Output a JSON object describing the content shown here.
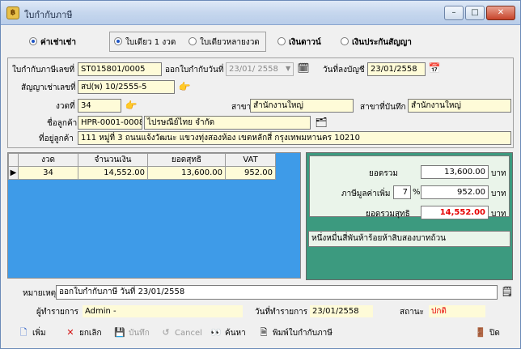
{
  "window": {
    "title": "ใบกำกับภาษี",
    "min": "–",
    "max": "□",
    "close": "✕"
  },
  "tax_type": {
    "options": [
      "ค่าเช่าเช่า",
      "เงินดาวน์",
      "เงินประกันสัญญา"
    ],
    "selected": "ค่าเช่าเช่า"
  },
  "invoice_mode": {
    "options": [
      "ใบเดียว 1 งวด",
      "ใบเดียวหลายงวด"
    ],
    "selected": "ใบเดียว 1 งวด"
  },
  "form": {
    "invoice_no_label": "ใบกำกับภาษีเลขที่",
    "invoice_no": "ST015801/0005",
    "issue_date_label": "ออกใบกำกับวันที่",
    "issue_date": "23/01/ 2558",
    "posting_date_label": "วันที่ลงบัญชี",
    "posting_date": "23/01/2558",
    "contract_no_label": "สัญญาเช่าเลขที่",
    "contract_no": "สป(พ) 10/2555-5",
    "installment_label": "งวดที่",
    "installment": "34",
    "branch_label": "สาขา",
    "branch": "สำนักงานใหญ่",
    "record_branch_label": "สาขาที่บันทึก",
    "record_branch": "สำนักงานใหญ่",
    "customer_name_label": "ชื่อลูกค้า",
    "customer_code": "HPR-0001-00082",
    "customer_name": "ไปรษณีย์ไทย จำกัด",
    "customer_address_label": "ที่อยู่ลูกค้า",
    "customer_address": "111 หมู่ที่ 3 ถนนแจ้งวัฒนะ แขวงทุ่งสองห้อง เขตหลักสี่ กรุงเทพมหานคร 10210"
  },
  "grid": {
    "columns": [
      "งวด",
      "จำนวนเงิน",
      "ยอดสุทธิ",
      "VAT"
    ],
    "rows": [
      {
        "installment": "34",
        "amount": "14,552.00",
        "net": "13,600.00",
        "vat": "952.00"
      }
    ]
  },
  "summary": {
    "total_label": "ยอดรวม",
    "total": "13,600.00",
    "vat_label": "ภาษีมูลค่าเพิ่ม",
    "vat_rate": "7",
    "pct": "%",
    "vat": "952.00",
    "grand_total_label": "ยอดรวมสุทธิ",
    "grand_total": "14,552.00",
    "unit": "บาท",
    "amount_in_words": "หนึ่งหมื่นสี่พันห้าร้อยห้าสิบสองบาทถ้วน"
  },
  "remarks": {
    "label": "หมายเหตุ",
    "value": "ออกใบกำกับภาษี วันที่ 23/01/2558"
  },
  "status": {
    "operator_label": "ผู้ทำรายการ",
    "operator": "Admin -",
    "txn_date_label": "วันที่ทำรายการ",
    "txn_date": "23/01/2558",
    "state_label": "สถานะ",
    "state": "ปกติ"
  },
  "toolbar": {
    "add": "เพิ่ม",
    "cancel_doc": "ยกเลิก",
    "save": "บันทึก",
    "cancel": "Cancel",
    "search": "ค้นหา",
    "print": "พิมพ์ใบกำกับภาษี",
    "exit": "ปิด"
  },
  "colors": {
    "grid_bg": "#3e9be8",
    "summary_bg": "#3c9a7f",
    "field_yellow": "#fefbd8",
    "grand_total": "#e60000",
    "status_red": "#e60000"
  }
}
